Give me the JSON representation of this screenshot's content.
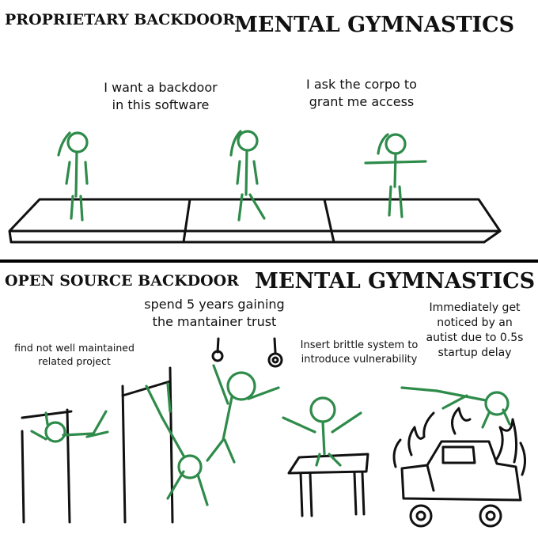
{
  "top": {
    "title_small": "PROPRIETARY BACKDOOR",
    "title_big": "MENTAL GYMNASTICS",
    "captions": {
      "c1": "I want a  backdoor\nin this software",
      "c2": "I ask the corpo to\ngrant me access"
    }
  },
  "bottom": {
    "title_small": "OPEN SOURCE BACKDOOR",
    "title_big": "MENTAL GYMNASTICS",
    "captions": {
      "c1": "find not well maintained\nrelated project",
      "c2": "spend 5 years gaining\nthe mantainer trust",
      "c3": "Insert brittle system to\nintroduce vulnerability",
      "c4": "Immediately get\nnoticed by an\nautist due to 0.5s\nstartup delay"
    }
  },
  "colors": {
    "figure": "#2e8b4a",
    "ink": "#111111",
    "fire": "#111111"
  }
}
